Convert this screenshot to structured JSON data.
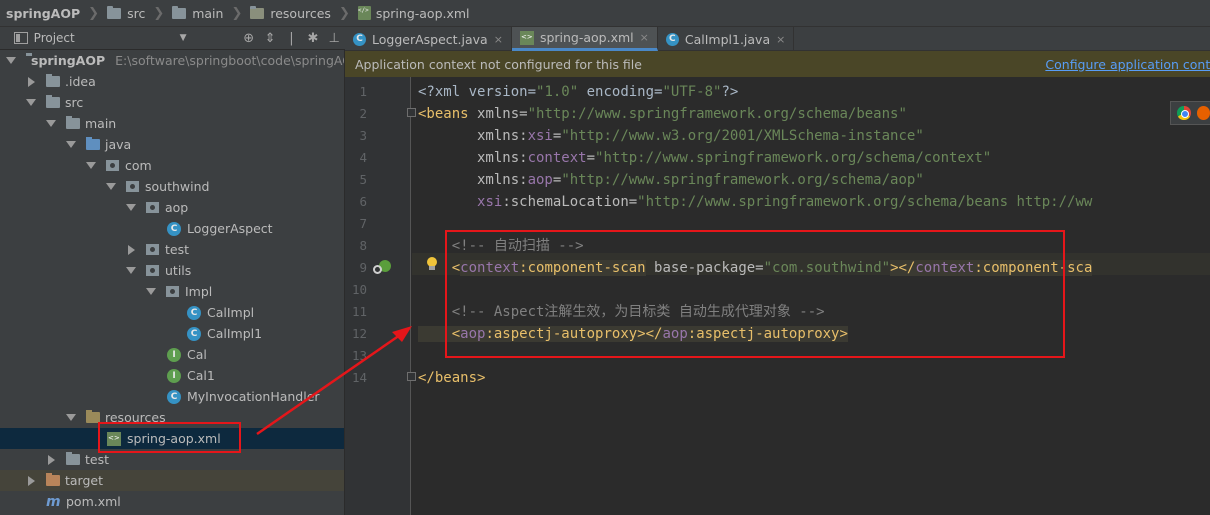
{
  "breadcrumb": {
    "items": [
      {
        "label": "springAOP",
        "icon": "folder-icon"
      },
      {
        "label": "src",
        "icon": "folder-icon"
      },
      {
        "label": "main",
        "icon": "folder-icon"
      },
      {
        "label": "resources",
        "icon": "resources-folder-icon"
      },
      {
        "label": "spring-aop.xml",
        "icon": "xml-file-icon"
      }
    ]
  },
  "project_panel": {
    "title": "Project",
    "tree": [
      {
        "label": "springAOP",
        "path": "E:\\software\\springboot\\code\\springAO",
        "icon": "module-folder-icon",
        "expanded": true
      },
      {
        "label": ".idea",
        "icon": "folder-icon",
        "expanded": false
      },
      {
        "label": "src",
        "icon": "folder-icon",
        "expanded": true
      },
      {
        "label": "main",
        "icon": "folder-icon",
        "expanded": true
      },
      {
        "label": "java",
        "icon": "source-folder-icon",
        "expanded": true
      },
      {
        "label": "com",
        "icon": "package-icon",
        "expanded": true
      },
      {
        "label": "southwind",
        "icon": "package-icon",
        "expanded": true
      },
      {
        "label": "aop",
        "icon": "package-icon",
        "expanded": true
      },
      {
        "label": "LoggerAspect",
        "icon": "class-icon"
      },
      {
        "label": "test",
        "icon": "package-icon",
        "expanded": false
      },
      {
        "label": "utils",
        "icon": "package-icon",
        "expanded": true
      },
      {
        "label": "Impl",
        "icon": "package-icon",
        "expanded": true
      },
      {
        "label": "CalImpl",
        "icon": "class-icon"
      },
      {
        "label": "CalImpl1",
        "icon": "class-icon"
      },
      {
        "label": "Cal",
        "icon": "interface-icon"
      },
      {
        "label": "Cal1",
        "icon": "interface-icon"
      },
      {
        "label": "MyInvocationHandler",
        "icon": "class-icon"
      },
      {
        "label": "resources",
        "icon": "resources-folder-icon",
        "expanded": true
      },
      {
        "label": "spring-aop.xml",
        "icon": "xml-file-icon",
        "selected": true
      },
      {
        "label": "test",
        "icon": "test-folder-icon",
        "expanded": false
      },
      {
        "label": "target",
        "icon": "target-folder-icon",
        "expanded": false
      },
      {
        "label": "pom.xml",
        "icon": "maven-icon"
      }
    ]
  },
  "tabs": [
    {
      "label": "LoggerAspect.java",
      "icon": "class-icon",
      "active": false
    },
    {
      "label": "spring-aop.xml",
      "icon": "xml-file-icon",
      "active": true
    },
    {
      "label": "CalImpl1.java",
      "icon": "class-icon",
      "active": false
    }
  ],
  "notification": {
    "message": "Application context not configured for this file",
    "action": "Configure application context"
  },
  "editor": {
    "line_numbers": [
      "1",
      "2",
      "3",
      "4",
      "5",
      "6",
      "7",
      "8",
      "9",
      "10",
      "11",
      "12",
      "13",
      "14"
    ],
    "lines": {
      "l1_a": "<?xml version=",
      "l1_b": "\"1.0\"",
      "l1_c": " encoding=",
      "l1_d": "\"UTF-8\"",
      "l1_e": "?>",
      "l2_a": "<beans ",
      "l2_b": "xmlns=",
      "l2_c": "\"http://www.springframework.org/schema/beans\"",
      "l3_a": "       xmlns:",
      "l3_b": "xsi",
      "l3_c": "=",
      "l3_d": "\"http://www.w3.org/2001/XMLSchema-instance\"",
      "l4_a": "       xmlns:",
      "l4_b": "context",
      "l4_c": "=",
      "l4_d": "\"http://www.springframework.org/schema/context\"",
      "l5_a": "       xmlns:",
      "l5_b": "aop",
      "l5_c": "=",
      "l5_d": "\"http://www.springframework.org/schema/aop\"",
      "l6_a": "       ",
      "l6_b": "xsi",
      "l6_c": ":schemaLocation=",
      "l6_d": "\"http://www.springframework.org/schema/beans http://ww",
      "l8": "    <!-- 自动扫描 -->",
      "l9_a": "    <",
      "l9_b": "context",
      "l9_c": ":component-scan",
      "l9_d": " base-package=",
      "l9_e": "\"com.southwind\"",
      "l9_f": "></",
      "l9_g": "context",
      "l9_h": ":component-sca",
      "l11": "    <!-- Aspect注解生效，为目标类 自动生成代理对象 -->",
      "l12_a": "    <",
      "l12_b": "aop",
      "l12_c": ":aspectj-autoproxy></",
      "l12_d": "aop",
      "l12_e": ":aspectj-autoproxy>",
      "l14": "</beans>"
    }
  },
  "colors": {
    "annotation_red": "#e5161a",
    "tag": "#e8bf6a",
    "string": "#6a8759",
    "namespace": "#9876aa",
    "comment": "#808080",
    "link": "#589df6"
  }
}
